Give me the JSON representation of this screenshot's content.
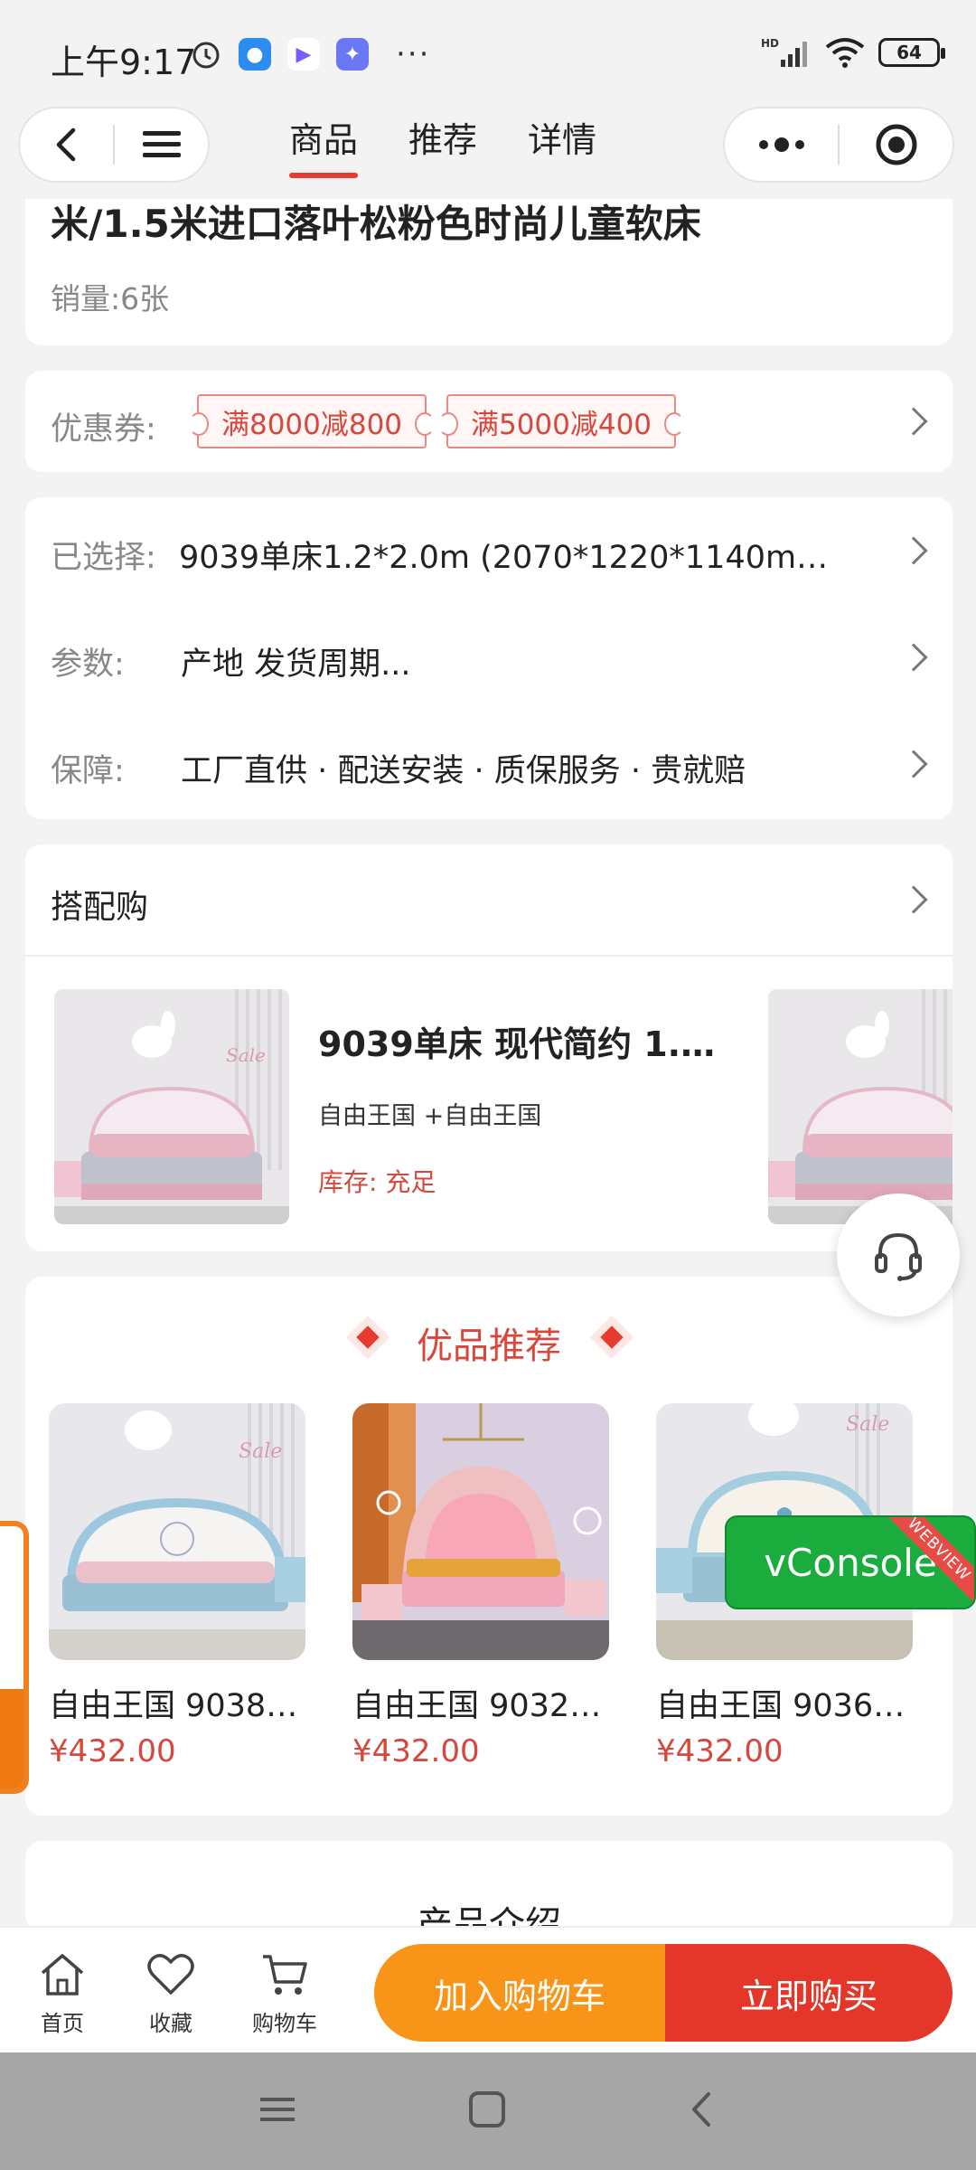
{
  "status_bar": {
    "time": "上午9:17",
    "battery": "64",
    "network": "HD"
  },
  "nav": {
    "tabs": [
      {
        "label": "商品",
        "active": true
      },
      {
        "label": "推荐",
        "active": false
      },
      {
        "label": "详情",
        "active": false
      }
    ]
  },
  "product": {
    "title": "米/1.5米进口落叶松粉色时尚儿童软床",
    "sales": "销量:6张"
  },
  "coupons": {
    "label": "优惠券:",
    "items": [
      "满8000减800",
      "满5000减400"
    ]
  },
  "info": {
    "selected": {
      "label": "已选择:",
      "value": "9039单床1.2*2.0m (2070*1220*1140m…"
    },
    "params": {
      "label": "参数:",
      "value": "产地  发货周期..."
    },
    "guarantee": {
      "label": "保障:",
      "value": "工厂直供 · 配送安装 · 质保服务 · 贵就赔"
    }
  },
  "combo": {
    "title": "搭配购",
    "item_name": "9039单床 现代简约 1.…",
    "item_sub": "自由王国 +自由王国",
    "item_stock": "库存: 充足"
  },
  "recommend": {
    "title": "优品推荐",
    "items": [
      {
        "name": "自由王国 9038…",
        "price": "¥432.00"
      },
      {
        "name": "自由王国 9032…",
        "price": "¥432.00"
      },
      {
        "name": "自由王国 9036…",
        "price": "¥432.00"
      }
    ]
  },
  "intro": {
    "title": "产品介绍"
  },
  "vconsole": {
    "label": "vConsole",
    "ribbon": "WEBVIEW"
  },
  "action_bar": {
    "home": "首页",
    "favorite": "收藏",
    "cart": "购物车",
    "add_to_cart": "加入购物车",
    "buy_now": "立即购买"
  },
  "colors": {
    "accent_red": "#e5362a",
    "accent_orange": "#f89518",
    "price_red": "#d8473c",
    "vconsole_green": "#1aad3e"
  },
  "icons": [
    "back-icon",
    "menu-icon",
    "more-dots-icon",
    "target-icon",
    "chevron-right-icon",
    "headset-icon",
    "home-icon",
    "heart-icon",
    "cart-icon"
  ]
}
